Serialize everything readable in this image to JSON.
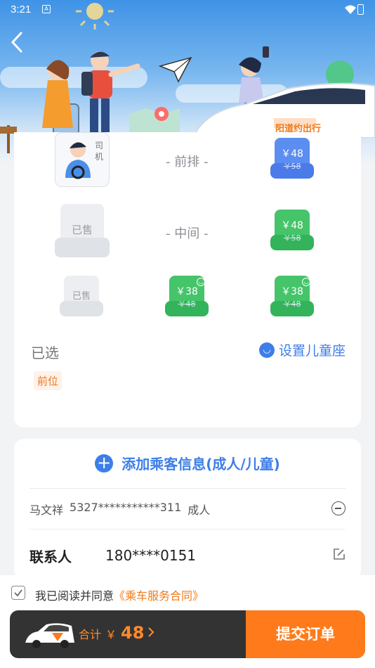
{
  "status_bar": {
    "time": "3:21",
    "notification_icon": "A"
  },
  "hero": {
    "brand_text": "阳道约出行"
  },
  "seat_map": {
    "driver_label": "司机",
    "row_front": "- 前排 -",
    "row_middle": "- 中间 -",
    "sold_label": "已售",
    "seats": {
      "front_right": {
        "price": "￥48",
        "original": "￥58",
        "color": "#5b8ef0"
      },
      "middle_right": {
        "price": "￥48",
        "original": "￥58",
        "color": "#45c46a"
      },
      "back_middle": {
        "price": "￥38",
        "original": "￥48",
        "color": "#45c46a"
      },
      "back_right": {
        "price": "￥38",
        "original": "￥48",
        "color": "#45c46a"
      }
    },
    "selected_label": "已选",
    "child_seat_label": "设置儿童座",
    "selected_tag": "前位"
  },
  "passenger": {
    "add_label": "添加乘客信息(成人/儿童)",
    "name": "马文祥",
    "id_masked": "5327***********311",
    "type": "成人",
    "contact_label": "联系人",
    "contact_phone": "180****0151"
  },
  "agreement": {
    "prefix": "我已阅读并同意",
    "link": "《乘车服务合同》"
  },
  "footer": {
    "total_label": "合计",
    "currency": "￥",
    "total_amount": "48",
    "submit_label": "提交订单"
  },
  "colors": {
    "accent_blue": "#3d7ee8",
    "accent_orange": "#ff7a1a",
    "footer_dark": "#333333"
  }
}
